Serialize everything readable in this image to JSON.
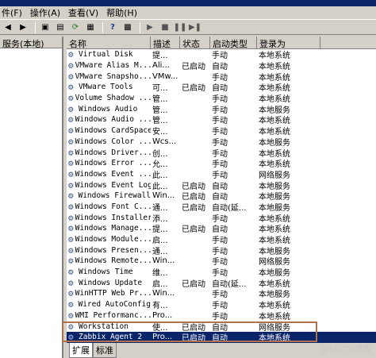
{
  "menu": [
    "件(F)",
    "操作(A)",
    "查看(V)",
    "帮助(H)"
  ],
  "left_tab": "服务(本地)",
  "columns": [
    "名称",
    "描述",
    "状态",
    "启动类型",
    "登录为"
  ],
  "rows": [
    {
      "name": "Virtual Disk",
      "desc": "提...",
      "status": "",
      "start": "手动",
      "logon": "本地系统"
    },
    {
      "name": "VMware Alias M...",
      "desc": "Ali...",
      "status": "已启动",
      "start": "自动",
      "logon": "本地系统"
    },
    {
      "name": "VMware Snapsho...",
      "desc": "VMw...",
      "status": "",
      "start": "手动",
      "logon": "本地系统"
    },
    {
      "name": "VMware Tools",
      "desc": "可...",
      "status": "已启动",
      "start": "自动",
      "logon": "本地系统"
    },
    {
      "name": "Volume Shadow ...",
      "desc": "管...",
      "status": "",
      "start": "手动",
      "logon": "本地系统"
    },
    {
      "name": "Windows Audio",
      "desc": "管...",
      "status": "",
      "start": "手动",
      "logon": "本地服务"
    },
    {
      "name": "Windows Audio ...",
      "desc": "管...",
      "status": "",
      "start": "手动",
      "logon": "本地系统"
    },
    {
      "name": "Windows CardSpace",
      "desc": "安...",
      "status": "",
      "start": "手动",
      "logon": "本地系统"
    },
    {
      "name": "Windows Color ...",
      "desc": "Wcs...",
      "status": "",
      "start": "手动",
      "logon": "本地服务"
    },
    {
      "name": "Windows Driver...",
      "desc": "创...",
      "status": "",
      "start": "手动",
      "logon": "本地系统"
    },
    {
      "name": "Windows Error ...",
      "desc": "允...",
      "status": "",
      "start": "手动",
      "logon": "本地系统"
    },
    {
      "name": "Windows Event ...",
      "desc": "此...",
      "status": "",
      "start": "手动",
      "logon": "网络服务"
    },
    {
      "name": "Windows Event Log",
      "desc": "此...",
      "status": "已启动",
      "start": "自动",
      "logon": "本地服务"
    },
    {
      "name": "Windows Firewall",
      "desc": "Win...",
      "status": "已启动",
      "start": "自动",
      "logon": "本地服务"
    },
    {
      "name": "Windows Font C...",
      "desc": "通...",
      "status": "已启动",
      "start": "自动(延...",
      "logon": "本地服务"
    },
    {
      "name": "Windows Installer",
      "desc": "添...",
      "status": "",
      "start": "手动",
      "logon": "本地系统"
    },
    {
      "name": "Windows Manage...",
      "desc": "提...",
      "status": "已启动",
      "start": "自动",
      "logon": "本地系统"
    },
    {
      "name": "Windows Module...",
      "desc": "启...",
      "status": "",
      "start": "手动",
      "logon": "本地系统"
    },
    {
      "name": "Windows Presen...",
      "desc": "通...",
      "status": "",
      "start": "手动",
      "logon": "本地服务"
    },
    {
      "name": "Windows Remote...",
      "desc": "Win...",
      "status": "",
      "start": "手动",
      "logon": "网络服务"
    },
    {
      "name": "Windows Time",
      "desc": "维...",
      "status": "",
      "start": "手动",
      "logon": "本地服务"
    },
    {
      "name": "Windows Update",
      "desc": "启...",
      "status": "已启动",
      "start": "自动(延...",
      "logon": "本地系统"
    },
    {
      "name": "WinHTTP Web Pr...",
      "desc": "Win...",
      "status": "",
      "start": "手动",
      "logon": "本地服务"
    },
    {
      "name": "Wired AutoConfig",
      "desc": "有...",
      "status": "",
      "start": "手动",
      "logon": "本地系统"
    },
    {
      "name": "WMI Performanc...",
      "desc": "Pro...",
      "status": "",
      "start": "手动",
      "logon": "本地系统"
    },
    {
      "name": "Workstation",
      "desc": "使...",
      "status": "已启动",
      "start": "自动",
      "logon": "网络服务"
    },
    {
      "name": "Zabbix Agent 2",
      "desc": "Pro...",
      "status": "已启动",
      "start": "自动",
      "logon": "本地系统",
      "selected": true
    }
  ],
  "bottom_tabs": [
    "扩展",
    "标准"
  ],
  "watermark": "@51CTO博客"
}
